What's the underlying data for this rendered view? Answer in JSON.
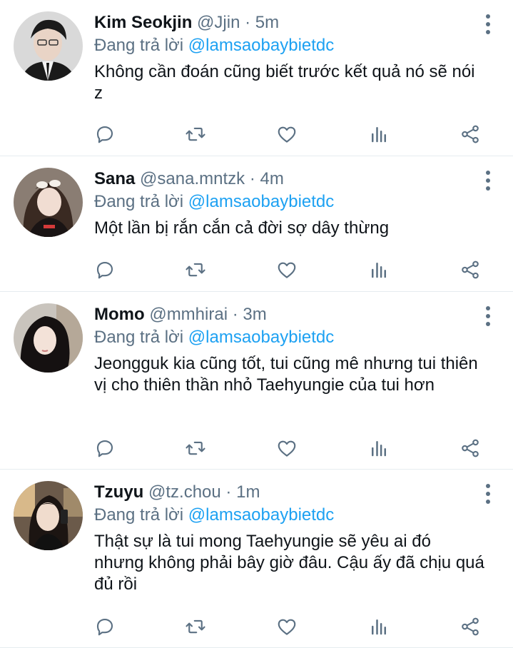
{
  "tweets": [
    {
      "name": "Kim Seokjin",
      "handle": "@Jjin",
      "dot": "·",
      "time": "5m",
      "reply_prefix": "Đang trả lời",
      "reply_to": "@lamsaobaybietdc",
      "text": "Không cần đoán cũng biết trước kết quả nó sẽ nói z"
    },
    {
      "name": "Sana",
      "handle": "@sana.mntzk",
      "dot": "·",
      "time": "4m",
      "reply_prefix": "Đang trả lời",
      "reply_to": "@lamsaobaybietdc",
      "text": "Một lần bị rắn cắn cả đời sợ dây thừng"
    },
    {
      "name": "Momo",
      "handle": "@mmhirai",
      "dot": "·",
      "time": "3m",
      "reply_prefix": "Đang trả lời",
      "reply_to": "@lamsaobaybietdc",
      "text": "Jeongguk kia cũng tốt, tui cũng mê nhưng tui thiên vị cho thiên thần nhỏ Taehyungie của tui hơn"
    },
    {
      "name": "Tzuyu",
      "handle": "@tz.chou",
      "dot": "·",
      "time": "1m",
      "reply_prefix": "Đang trả lời",
      "reply_to": "@lamsaobaybietdc",
      "text": "Thật sự là tui mong Taehyungie sẽ yêu ai đó nhưng không phải bây giờ đâu. Cậu ấy đã chịu quá đủ rồi"
    }
  ],
  "icons": {
    "reply": "reply-icon",
    "retweet": "retweet-icon",
    "like": "heart-icon",
    "stats": "stats-icon",
    "share": "share-icon",
    "more": "more-vertical-icon"
  },
  "colors": {
    "link": "#1da1f2",
    "muted": "#5b7083",
    "text": "#0f1419",
    "divider": "#e6ecf0"
  }
}
